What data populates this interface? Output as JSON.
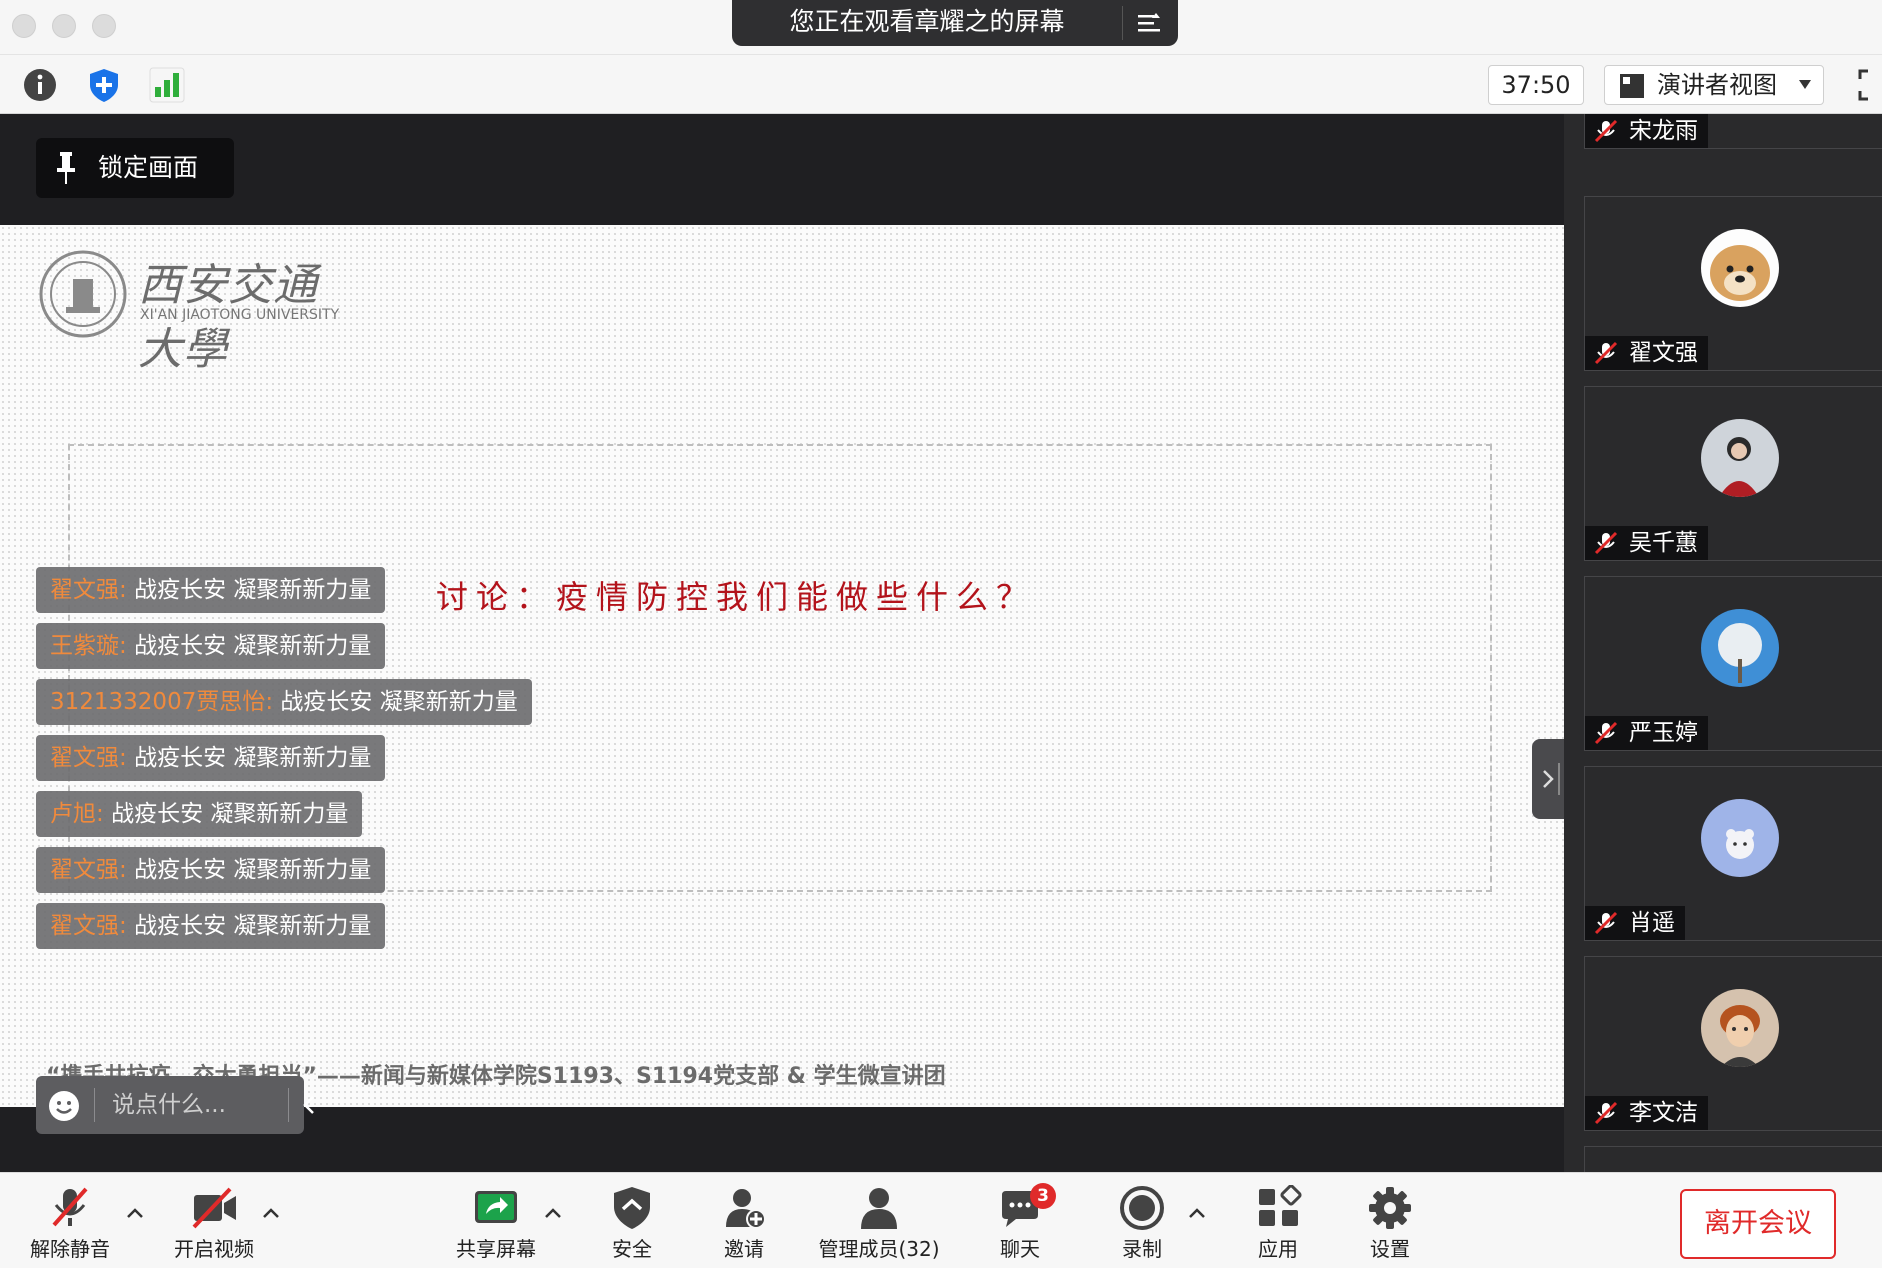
{
  "titlebar": {
    "banner_title": "您正在观看章耀之的屏幕"
  },
  "toolbar": {
    "timer": "37:50",
    "view_label": "演讲者视图"
  },
  "stage": {
    "lock_label": "锁定画面",
    "slide": {
      "logo_cn": "西安交通大學",
      "logo_en": "XI'AN JIAOTONG UNIVERSITY",
      "discussion": "讨论：疫情防控我们能做些什么？",
      "footer": "“携手共抗疫，交大勇担当”——新闻与新媒体学院S1193、S1194党支部 & 学生微宣讲团"
    }
  },
  "chat": {
    "messages": [
      {
        "sender": "翟文强:",
        "text": "战疫长安 凝聚新新力量"
      },
      {
        "sender": "王紫璇:",
        "text": "战疫长安 凝聚新新力量"
      },
      {
        "sender": "3121332007贾思怡:",
        "text": "战疫长安 凝聚新新力量"
      },
      {
        "sender": "翟文强:",
        "text": "战疫长安 凝聚新新力量"
      },
      {
        "sender": "卢旭:",
        "text": "战疫长安 凝聚新新力量"
      },
      {
        "sender": "翟文强:",
        "text": "战疫长安 凝聚新新力量"
      },
      {
        "sender": "翟文强:",
        "text": "战疫长安 凝聚新新力量"
      }
    ],
    "placeholder": "说点什么..."
  },
  "gallery": {
    "partial_top_name": "宋龙雨",
    "participants": [
      {
        "name": "翟文强",
        "avatar": "dog-photo"
      },
      {
        "name": "吴千蕙",
        "avatar": "person-photo"
      },
      {
        "name": "严玉婷",
        "avatar": "tree-photo"
      },
      {
        "name": "肖遥",
        "avatar": "bear-cartoon"
      },
      {
        "name": "李文洁",
        "avatar": "redhead-photo"
      }
    ]
  },
  "bottombar": {
    "unmute": "解除静音",
    "start_video": "开启视频",
    "share_screen": "共享屏幕",
    "security": "安全",
    "invite": "邀请",
    "participants": "管理成员(32)",
    "chat": "聊天",
    "chat_badge": "3",
    "record": "录制",
    "apps": "应用",
    "settings": "设置",
    "leave": "离开会议"
  },
  "colors": {
    "accent_red": "#e02a2a",
    "chat_sender": "#f08a3c",
    "slide_title": "#b3131b"
  }
}
